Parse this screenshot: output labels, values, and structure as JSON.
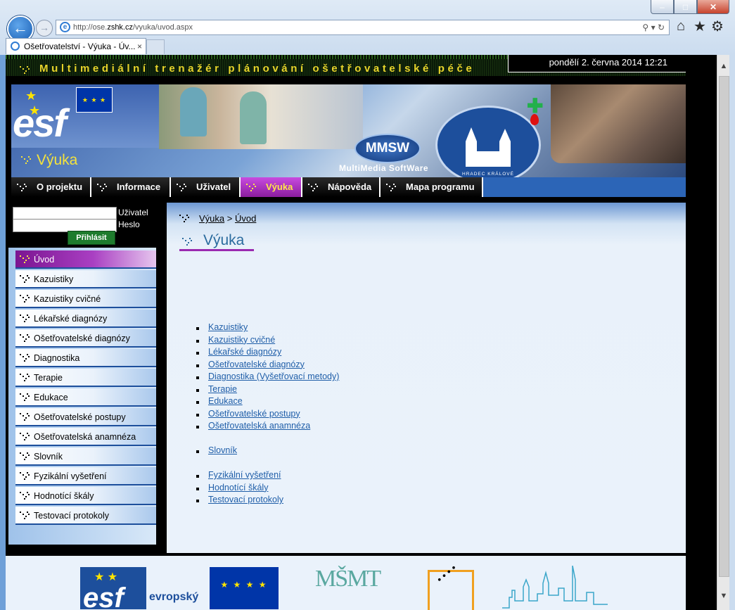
{
  "browser": {
    "url_prefix": "http://ose.",
    "url_domain": "zshk.cz",
    "url_path": "/vyuka/uvod.aspx",
    "tab_title": "Ošetřovatelství - Výuka - Úv...",
    "tab_close": "×",
    "window_controls": [
      "–",
      "□",
      "✕"
    ],
    "back_icon": "back-arrow-icon",
    "forward_icon": "forward-arrow-icon"
  },
  "site": {
    "title": "Multimediální trenažér plánování ošetřovatelské péče",
    "date": "pondělí 2. června 2014 12:21",
    "section_heading": "Výuka",
    "mmsw": "MMSW",
    "mmsw_sub": "MultiMedia SoftWare",
    "seal_city": "HRADEC KRÁLOVÉ",
    "esf": "esf"
  },
  "nav": {
    "items": [
      {
        "label": "O projektu",
        "active": false
      },
      {
        "label": "Informace",
        "active": false
      },
      {
        "label": "Uživatel",
        "active": false
      },
      {
        "label": "Výuka",
        "active": true
      },
      {
        "label": "Nápověda",
        "active": false
      },
      {
        "label": "Mapa programu",
        "active": false
      }
    ]
  },
  "login": {
    "user_label": "Uživatel",
    "pass_label": "Heslo",
    "user_value": "",
    "pass_value": "",
    "button": "Přihlásit"
  },
  "sidebar": {
    "items": [
      {
        "label": "Úvod",
        "active": true
      },
      {
        "label": "Kazuistiky",
        "active": false
      },
      {
        "label": "Kazuistiky cvičné",
        "active": false
      },
      {
        "label": "Lékařské diagnózy",
        "active": false
      },
      {
        "label": "Ošetřovatelské diagnózy",
        "active": false
      },
      {
        "label": "Diagnostika",
        "active": false
      },
      {
        "label": "Terapie",
        "active": false
      },
      {
        "label": "Edukace",
        "active": false
      },
      {
        "label": "Ošetřovatelské postupy",
        "active": false
      },
      {
        "label": "Ošetřovatelská anamnéza",
        "active": false
      },
      {
        "label": "Slovník",
        "active": false
      },
      {
        "label": "Fyzikální vyšetření",
        "active": false
      },
      {
        "label": "Hodnotící škály",
        "active": false
      },
      {
        "label": "Testovací protokoly",
        "active": false
      }
    ]
  },
  "content": {
    "breadcrumb": [
      {
        "label": "Výuka"
      },
      {
        "label": "Úvod"
      }
    ],
    "breadcrumb_sep": ">",
    "title": "Výuka",
    "groups": [
      [
        "Kazuistiky",
        "Kazuistiky cvičné",
        "Lékařské diagnózy",
        "Ošetřovatelské diagnózy",
        "Diagnostika (Vyšetřovací metody)",
        "Terapie",
        "Edukace",
        "Ošetřovatelské postupy",
        "Ošetřovatelská anamnéza"
      ],
      [
        "Slovník"
      ],
      [
        "Fyzikální vyšetření",
        "Hodnotící škály",
        "Testovací protokoly"
      ]
    ]
  },
  "footer": {
    "esf_text": "esf",
    "evropsky": "evropský",
    "msmt": "MŠMT"
  },
  "colors": {
    "accent_purple": "#9a2ab0",
    "nav_blue": "#2c65b7",
    "title_yellow": "#e8d42b",
    "link_blue": "#1f5ea8"
  }
}
